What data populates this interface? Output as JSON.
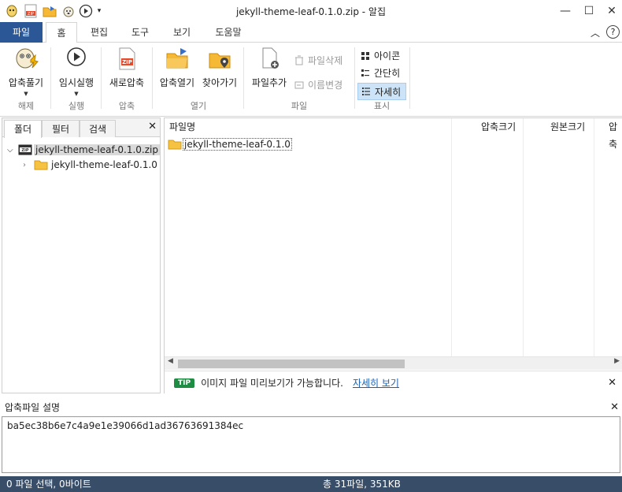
{
  "window": {
    "title": "jekyll-theme-leaf-0.1.0.zip - 알집",
    "minimize": "—",
    "maximize": "☐",
    "close": "✕"
  },
  "quick_access": {
    "icons": [
      "alzip-logo-icon",
      "zip-icon",
      "folder-open-icon",
      "dog-icon",
      "play-icon",
      "dropdown-icon"
    ]
  },
  "tabs": [
    "파일",
    "홈",
    "편집",
    "도구",
    "보기",
    "도움말"
  ],
  "ribbon": {
    "extract": "압축풀기",
    "run_temp": "임시실행",
    "new_zip": "새로압축",
    "open_zip": "압축열기",
    "find": "찾아가기",
    "add_file": "파일추가",
    "delete_file": "파일삭제",
    "rename": "이름변경",
    "view_icon": "아이콘",
    "view_simple": "간단히",
    "view_detail": "자세히",
    "groups": {
      "extract": "해제",
      "run": "실행",
      "compress": "압축",
      "open": "열기",
      "file": "파일",
      "view": "표시"
    }
  },
  "left_panel": {
    "tabs": [
      "폴더",
      "필터",
      "검색"
    ],
    "close": "✕",
    "tree": [
      {
        "label": "jekyll-theme-leaf-0.1.0.zip"
      },
      {
        "label": "jekyll-theme-leaf-0.1.0"
      }
    ]
  },
  "file_list": {
    "columns": [
      "파일명",
      "압축크기",
      "원본크기",
      "압축"
    ],
    "rows": [
      {
        "name": "jekyll-theme-leaf-0.1.0"
      }
    ]
  },
  "tip": {
    "badge": "TIP",
    "text": "이미지 파일 미리보기가 가능합니다.",
    "link": "자세히 보기",
    "close": "✕"
  },
  "description": {
    "title": "압축파일 설명",
    "close": "✕",
    "text": "ba5ec38b6e7c4a9e1e39066d1ad36763691384ec"
  },
  "status": {
    "left": "0 파일 선택,  0바이트",
    "right": "총 31파일,  351KB"
  },
  "colors": {
    "file_tab": "#2b5797",
    "status_bar": "#384d68",
    "tip_green": "#1e8c43",
    "selected_view": "#cde3f7"
  }
}
